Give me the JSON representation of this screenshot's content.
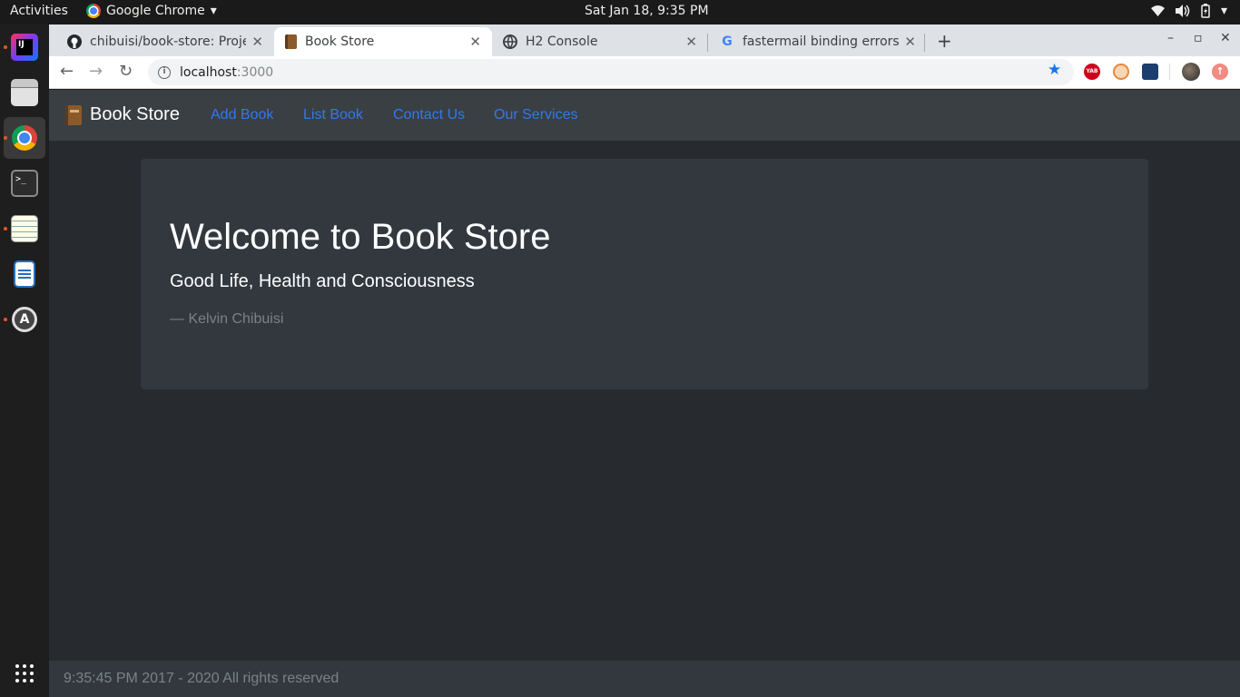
{
  "system_bar": {
    "activities": "Activities",
    "app_name": "Google Chrome",
    "clock": "Sat Jan 18,  9:35 PM",
    "tray_icons": [
      "wifi-icon",
      "volume-icon",
      "battery-icon",
      "power-menu-icon"
    ]
  },
  "dock": {
    "items": [
      "intellij-icon",
      "file-manager-icon",
      "chrome-icon",
      "terminal-icon",
      "text-editor-icon",
      "writer-icon",
      "software-updater-icon",
      "show-apps-icon"
    ],
    "active": "chrome-icon"
  },
  "tabs": [
    {
      "title": "chibuisi/book-store: Proje",
      "favicon": "github-icon",
      "active": false
    },
    {
      "title": "Book Store",
      "favicon": "book-icon",
      "active": true
    },
    {
      "title": "H2 Console",
      "favicon": "globe-icon",
      "active": false
    },
    {
      "title": "fastermail binding errors",
      "favicon": "google-icon",
      "active": false
    }
  ],
  "omnibox": {
    "host": "localhost",
    "port": ":3000"
  },
  "extensions": [
    "yab-extension-icon",
    "orange-extension-icon",
    "blue-extension-icon",
    "profile-avatar-icon",
    "update-icon"
  ],
  "navbar": {
    "brand": "Book Store",
    "links": [
      "Add Book",
      "List Book",
      "Contact Us",
      "Our Services"
    ]
  },
  "jumbotron": {
    "heading": "Welcome to Book Store",
    "lead": "Good Life, Health and Consciousness",
    "citation": "— Kelvin Chibuisi"
  },
  "footer": {
    "text": "9:35:45 PM 2017 - 2020 All rights reserved"
  },
  "colors": {
    "page_bg": "#272b30",
    "navbar_bg": "#3a3f44",
    "card_bg": "#32383e",
    "link": "#3279e8",
    "muted": "#7a8288"
  }
}
